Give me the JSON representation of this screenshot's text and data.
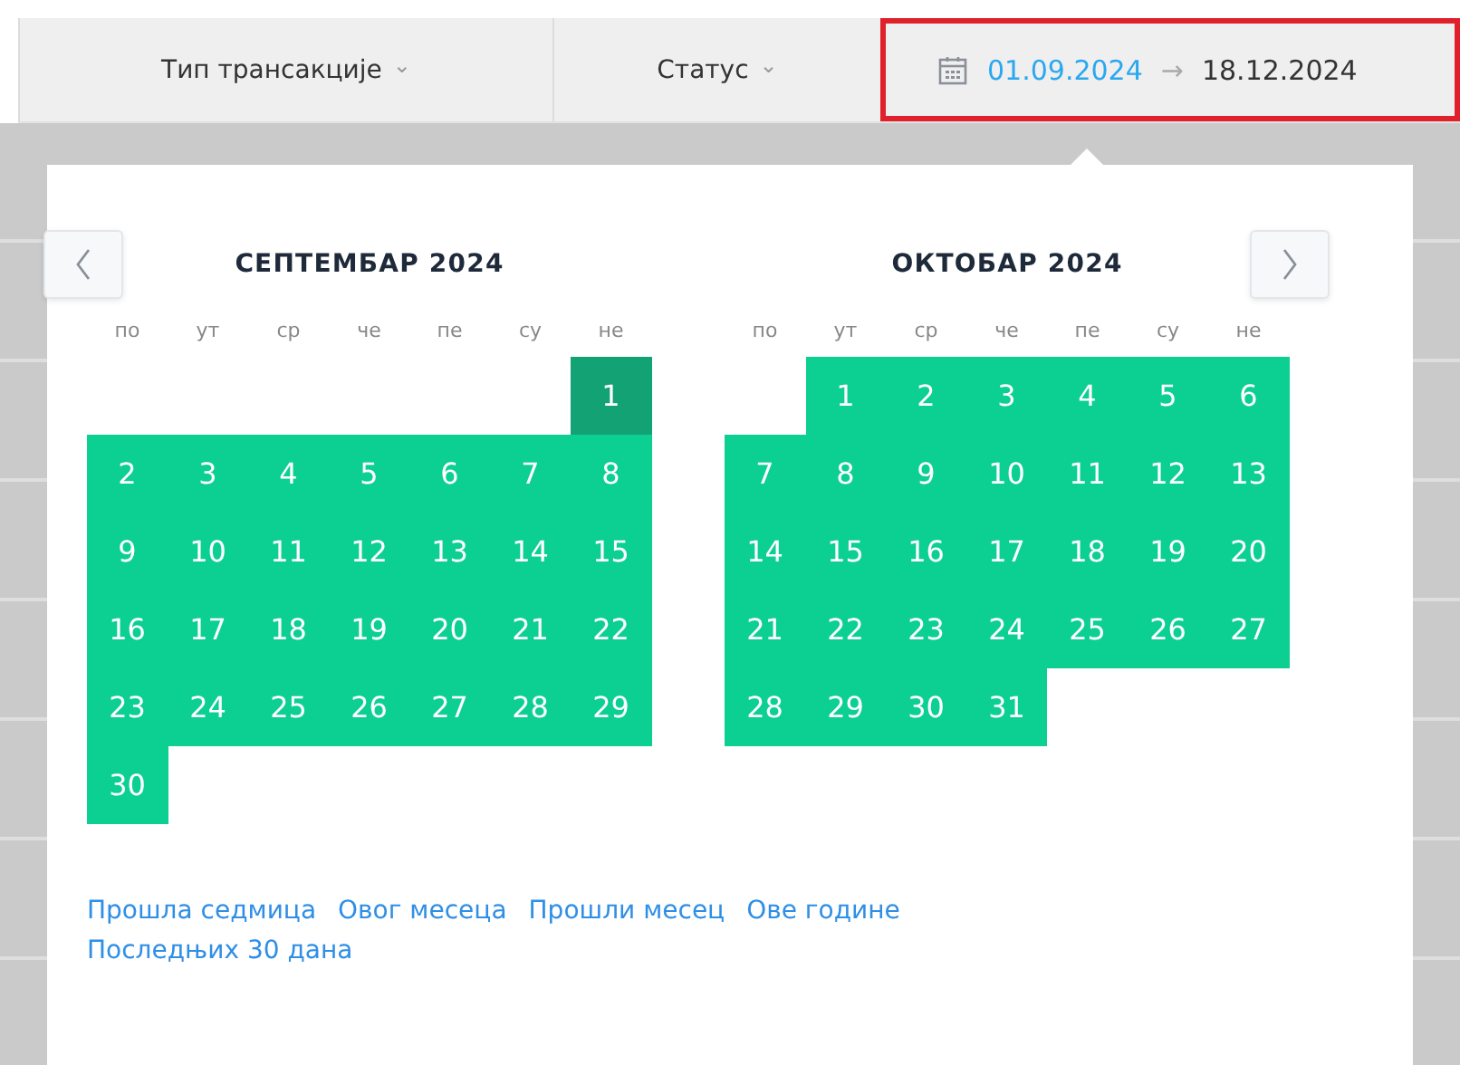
{
  "filters": [
    {
      "label": "Тип трансакције",
      "caret": "⌄"
    },
    {
      "label": "Статус",
      "caret": "⌄"
    }
  ],
  "date_range": {
    "start": "01.09.2024",
    "arrow": "→",
    "end": "18.12.2024",
    "highlighted": true
  },
  "calendars": [
    {
      "title": "СЕПТЕМБАР 2024",
      "weekdays": [
        "по",
        "ут",
        "ср",
        "че",
        "пе",
        "су",
        "не"
      ],
      "weeks": [
        [
          {
            "kind": "blank"
          },
          {
            "kind": "blank"
          },
          {
            "kind": "blank"
          },
          {
            "kind": "blank"
          },
          {
            "kind": "blank"
          },
          {
            "kind": "blank"
          },
          {
            "kind": "day",
            "day": "1",
            "selected": true
          }
        ],
        [
          {
            "kind": "day",
            "day": "2",
            "selected": false,
            "in_range": true
          },
          {
            "kind": "day",
            "day": "3",
            "selected": false,
            "in_range": true
          },
          {
            "kind": "day",
            "day": "4",
            "selected": false,
            "in_range": true
          },
          {
            "kind": "day",
            "day": "5",
            "selected": false,
            "in_range": true
          },
          {
            "kind": "day",
            "day": "6",
            "selected": false,
            "in_range": true
          },
          {
            "kind": "day",
            "day": "7",
            "selected": false,
            "in_range": true
          },
          {
            "kind": "day",
            "day": "8",
            "selected": false,
            "in_range": true
          }
        ],
        [
          {
            "kind": "day",
            "day": "9",
            "selected": false,
            "in_range": true
          },
          {
            "kind": "day",
            "day": "10",
            "selected": false,
            "in_range": true
          },
          {
            "kind": "day",
            "day": "11",
            "selected": false,
            "in_range": true
          },
          {
            "kind": "day",
            "day": "12",
            "selected": false,
            "in_range": true
          },
          {
            "kind": "day",
            "day": "13",
            "selected": false,
            "in_range": true
          },
          {
            "kind": "day",
            "day": "14",
            "selected": false,
            "in_range": true
          },
          {
            "kind": "day",
            "day": "15",
            "selected": false,
            "in_range": true
          }
        ],
        [
          {
            "kind": "day",
            "day": "16",
            "selected": false,
            "in_range": true
          },
          {
            "kind": "day",
            "day": "17",
            "selected": false,
            "in_range": true
          },
          {
            "kind": "day",
            "day": "18",
            "selected": false,
            "in_range": true
          },
          {
            "kind": "day",
            "day": "19",
            "selected": false,
            "in_range": true
          },
          {
            "kind": "day",
            "day": "20",
            "selected": false,
            "in_range": true
          },
          {
            "kind": "day",
            "day": "21",
            "selected": false,
            "in_range": true
          },
          {
            "kind": "day",
            "day": "22",
            "selected": false,
            "in_range": true
          }
        ],
        [
          {
            "kind": "day",
            "day": "23",
            "selected": false,
            "in_range": true
          },
          {
            "kind": "day",
            "day": "24",
            "selected": false,
            "in_range": true
          },
          {
            "kind": "day",
            "day": "25",
            "selected": false,
            "in_range": true
          },
          {
            "kind": "day",
            "day": "26",
            "selected": false,
            "in_range": true
          },
          {
            "kind": "day",
            "day": "27",
            "selected": false,
            "in_range": true
          },
          {
            "kind": "day",
            "day": "28",
            "selected": false,
            "in_range": true
          },
          {
            "kind": "day",
            "day": "29",
            "selected": false,
            "in_range": true
          }
        ],
        [
          {
            "kind": "day",
            "day": "30",
            "selected": false,
            "in_range": true
          }
        ]
      ]
    },
    {
      "title": "ОКТОБАР 2024",
      "weekdays": [
        "по",
        "ут",
        "ср",
        "че",
        "пе",
        "су",
        "не"
      ],
      "weeks": [
        [
          {
            "kind": "blank"
          },
          {
            "kind": "day",
            "day": "1",
            "selected": false,
            "in_range": true
          },
          {
            "kind": "day",
            "day": "2",
            "selected": false,
            "in_range": true
          },
          {
            "kind": "day",
            "day": "3",
            "selected": false,
            "in_range": true
          },
          {
            "kind": "day",
            "day": "4",
            "selected": false,
            "in_range": true
          },
          {
            "kind": "day",
            "day": "5",
            "selected": false,
            "in_range": true
          },
          {
            "kind": "day",
            "day": "6",
            "selected": false,
            "in_range": true
          }
        ],
        [
          {
            "kind": "day",
            "day": "7",
            "selected": false,
            "in_range": true
          },
          {
            "kind": "day",
            "day": "8",
            "selected": false,
            "in_range": true
          },
          {
            "kind": "day",
            "day": "9",
            "selected": false,
            "in_range": true
          },
          {
            "kind": "day",
            "day": "10",
            "selected": false,
            "in_range": true
          },
          {
            "kind": "day",
            "day": "11",
            "selected": false,
            "in_range": true
          },
          {
            "kind": "day",
            "day": "12",
            "selected": false,
            "in_range": true
          },
          {
            "kind": "day",
            "day": "13",
            "selected": false,
            "in_range": true
          }
        ],
        [
          {
            "kind": "day",
            "day": "14",
            "selected": false,
            "in_range": true
          },
          {
            "kind": "day",
            "day": "15",
            "selected": false,
            "in_range": true
          },
          {
            "kind": "day",
            "day": "16",
            "selected": false,
            "in_range": true
          },
          {
            "kind": "day",
            "day": "17",
            "selected": false,
            "in_range": true
          },
          {
            "kind": "day",
            "day": "18",
            "selected": false,
            "in_range": true
          },
          {
            "kind": "day",
            "day": "19",
            "selected": false,
            "in_range": true
          },
          {
            "kind": "day",
            "day": "20",
            "selected": false,
            "in_range": true
          }
        ],
        [
          {
            "kind": "day",
            "day": "21",
            "selected": false,
            "in_range": true
          },
          {
            "kind": "day",
            "day": "22",
            "selected": false,
            "in_range": true
          },
          {
            "kind": "day",
            "day": "23",
            "selected": false,
            "in_range": true
          },
          {
            "kind": "day",
            "day": "24",
            "selected": false,
            "in_range": true
          },
          {
            "kind": "day",
            "day": "25",
            "selected": false,
            "in_range": true
          },
          {
            "kind": "day",
            "day": "26",
            "selected": false,
            "in_range": true
          },
          {
            "kind": "day",
            "day": "27",
            "selected": false,
            "in_range": true
          }
        ],
        [
          {
            "kind": "day",
            "day": "28",
            "selected": false,
            "in_range": true
          },
          {
            "kind": "day",
            "day": "29",
            "selected": false,
            "in_range": true
          },
          {
            "kind": "day",
            "day": "30",
            "selected": false,
            "in_range": true
          },
          {
            "kind": "day",
            "day": "31",
            "selected": false,
            "in_range": true
          }
        ]
      ]
    }
  ],
  "presets": [
    "Прошла седмица",
    "Овог месеца",
    "Прошли месец",
    "Ове године",
    "Последњих 30 дана"
  ]
}
